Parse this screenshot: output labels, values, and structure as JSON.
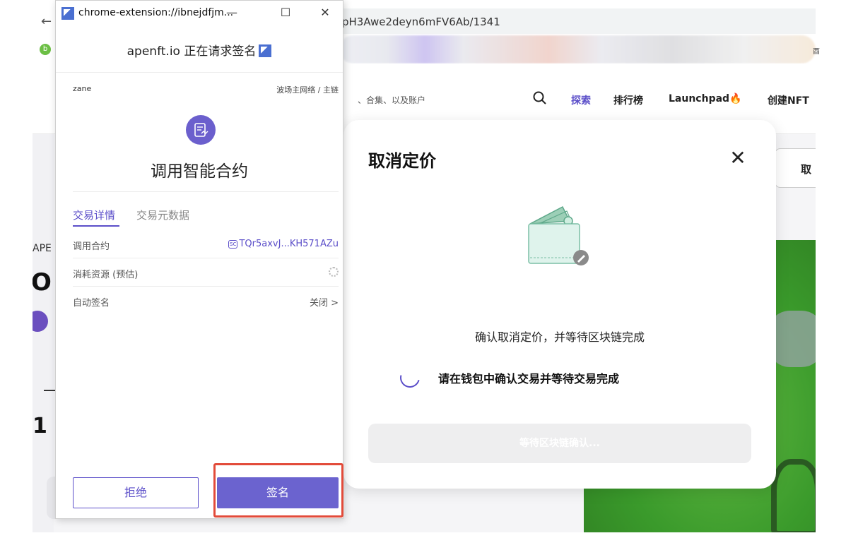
{
  "browser": {
    "url_fragment": "pH3Awe2deyn6mFV6Ab/1341",
    "bookmark_first": "b",
    "bookmarks_tail": "酉"
  },
  "site": {
    "search_hint": "、合集、以及账户",
    "nav": [
      "探索",
      "排行榜",
      "Launchpad",
      "创建NFT"
    ],
    "nav_flame": "🔥",
    "partial_button": "取",
    "left_partial_labels": {
      "ape": "APE",
      "o": "O",
      "one": "1",
      "tilde": "~"
    }
  },
  "modal": {
    "title": "取消定价",
    "close_glyph": "✕",
    "description": "确认取消定价，并等待区块链完成",
    "status": "请在钱包中确认交易并等待交易完成",
    "button": "等待区块链确认..."
  },
  "popup": {
    "window_title": "chrome-extension://ibnejdfjm...",
    "win_controls": {
      "minimize": "—",
      "maximize": "☐",
      "close": "✕"
    },
    "request_text": "apenft.io 正在请求签名",
    "account": "zane",
    "network": "波场主网络 / 主链",
    "main_title": "调用智能合约",
    "tabs": {
      "details": "交易详情",
      "metadata": "交易元数据"
    },
    "rows": [
      {
        "label": "调用合约",
        "badge": "sc",
        "value": "TQr5axvJ...KH571AZu"
      },
      {
        "label": "消耗资源 (预估)",
        "value": ""
      },
      {
        "label": "自动签名",
        "value": "关闭 >"
      }
    ],
    "reject_button": "拒绝",
    "sign_button": "签名"
  },
  "colors": {
    "accent": "#5b4ec9",
    "sign_button": "#6b63cf",
    "highlight": "#e24b3a",
    "green_panel": "#3a9a2b"
  }
}
